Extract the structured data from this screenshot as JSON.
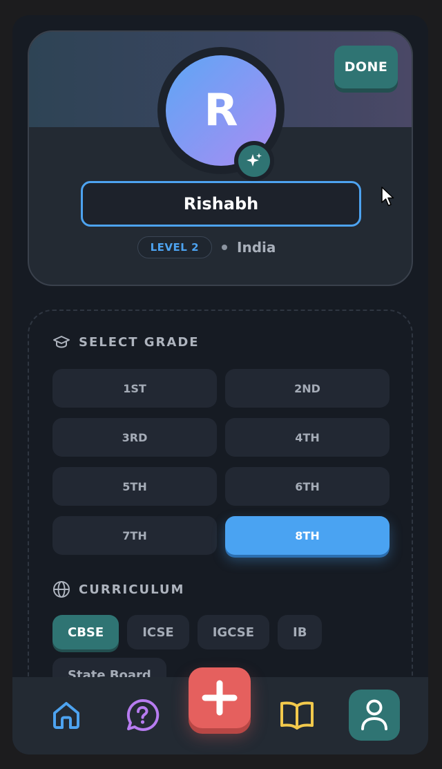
{
  "profile": {
    "done_label": "DONE",
    "avatar_initial": "R",
    "name_value": "Rishabh",
    "level_label": "LEVEL 2",
    "country": "India"
  },
  "grade_section": {
    "title": "SELECT GRADE",
    "grades": [
      "1ST",
      "2ND",
      "3RD",
      "4TH",
      "5TH",
      "6TH",
      "7TH",
      "8TH"
    ],
    "selected": "8TH"
  },
  "curriculum_section": {
    "title": "CURRICULUM",
    "options": [
      "CBSE",
      "ICSE",
      "IGCSE",
      "IB",
      "State Board"
    ],
    "selected": "CBSE"
  },
  "nav": {
    "items": [
      {
        "icon": "home-icon",
        "color": "#4da3f0"
      },
      {
        "icon": "help-chat-icon",
        "color": "#b77cf0"
      },
      {
        "icon": "add-icon",
        "color": "#ffffff"
      },
      {
        "icon": "book-icon",
        "color": "#f2c94c"
      },
      {
        "icon": "user-icon",
        "color": "#ffffff"
      }
    ],
    "active": "user-icon"
  },
  "colors": {
    "accent_blue": "#4aa3f2",
    "accent_teal": "#2f7473",
    "accent_red": "#e5605e"
  }
}
